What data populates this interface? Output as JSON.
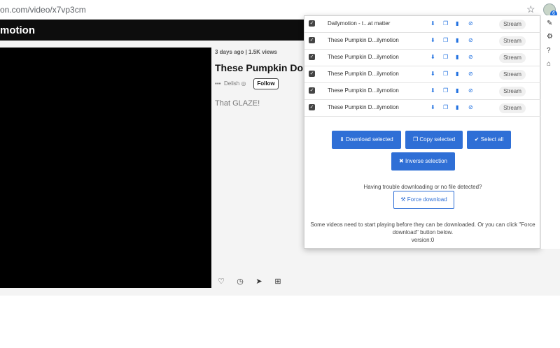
{
  "browser": {
    "url": "on.com/video/x7vp3cm",
    "extension_badge": "6"
  },
  "site": {
    "logo": "motion"
  },
  "video": {
    "meta": "3 days ago  |  1.5K views",
    "title": "These Pumpkin Dor",
    "channel": "Delish",
    "follow_label": "Follow",
    "description": "That GLAZE!"
  },
  "popup": {
    "rows": [
      {
        "name": "Dailymotion - t...at matter",
        "stream": "Stream"
      },
      {
        "name": "These Pumpkin D...ilymotion",
        "stream": "Stream"
      },
      {
        "name": "These Pumpkin D...ilymotion",
        "stream": "Stream"
      },
      {
        "name": "These Pumpkin D...ilymotion",
        "stream": "Stream"
      },
      {
        "name": "These Pumpkin D...ilymotion",
        "stream": "Stream"
      },
      {
        "name": "These Pumpkin D...ilymotion",
        "stream": "Stream"
      }
    ],
    "download_selected": "Download selected",
    "copy_selected": "Copy selected",
    "select_all": "Select all",
    "inverse_selection": "Inverse selection",
    "trouble_text": "Having trouble downloading or no file detected?",
    "force_download": "Force download",
    "note": "Some videos need to start playing before they can be downloaded. Or you can click \"Force download\" button below.",
    "version": "version:0"
  },
  "icons": {
    "download": "download-icon",
    "copy": "copy-icon",
    "file": "file-icon",
    "block": "block-icon",
    "pin": "pin-icon",
    "settings": "gear-icon",
    "help": "help-icon",
    "home": "home-icon"
  },
  "colors": {
    "accent": "#2f6fd6",
    "topbar": "#0d0d0d"
  }
}
